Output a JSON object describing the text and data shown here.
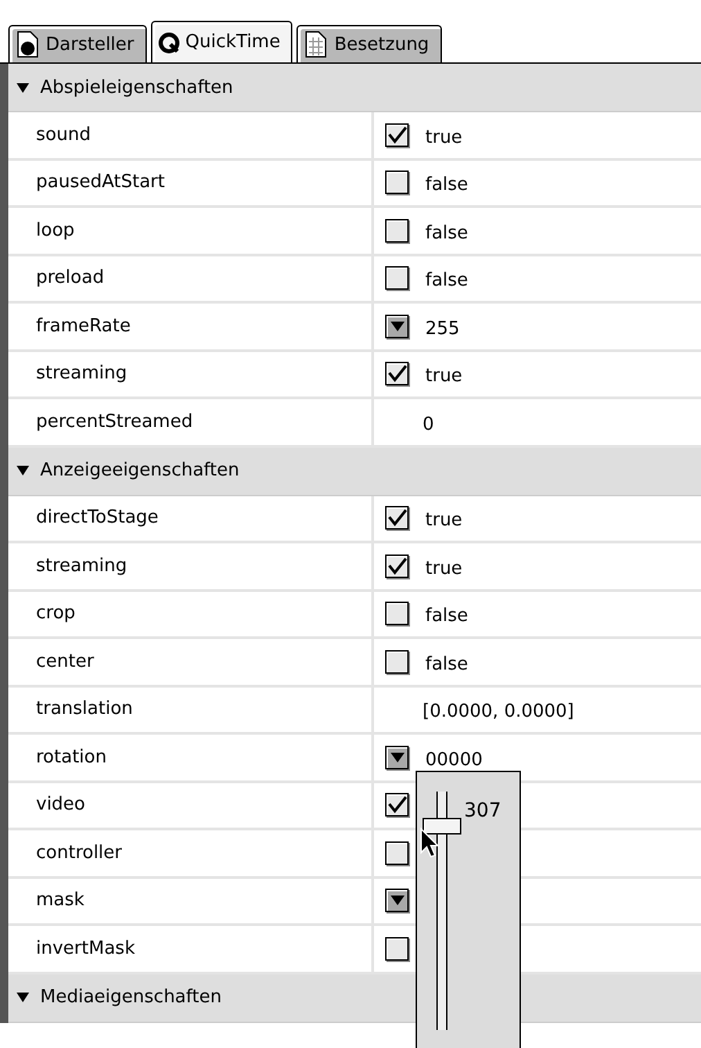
{
  "tabs": [
    {
      "label": "Darsteller",
      "kind": "member",
      "selected": false
    },
    {
      "label": "QuickTime",
      "kind": "quicktime",
      "selected": true
    },
    {
      "label": "Besetzung",
      "kind": "cast",
      "selected": false
    }
  ],
  "sections": [
    {
      "title": "Abspieleigenschaften",
      "expanded": true,
      "rows": [
        {
          "name": "sound",
          "kind": "checkbox",
          "checked": true,
          "value": "true"
        },
        {
          "name": "pausedAtStart",
          "kind": "checkbox",
          "checked": false,
          "value": "false"
        },
        {
          "name": "loop",
          "kind": "checkbox",
          "checked": false,
          "value": "false"
        },
        {
          "name": "preload",
          "kind": "checkbox",
          "checked": false,
          "value": "false"
        },
        {
          "name": "frameRate",
          "kind": "dropdown",
          "value": "255"
        },
        {
          "name": "streaming",
          "kind": "checkbox",
          "checked": true,
          "value": "true"
        },
        {
          "name": "percentStreamed",
          "kind": "text",
          "value": "0"
        }
      ]
    },
    {
      "title": "Anzeigeeigenschaften",
      "expanded": true,
      "rows": [
        {
          "name": "directToStage",
          "kind": "checkbox",
          "checked": true,
          "value": "true"
        },
        {
          "name": "streaming",
          "kind": "checkbox",
          "checked": true,
          "value": "true"
        },
        {
          "name": "crop",
          "kind": "checkbox",
          "checked": false,
          "value": "false"
        },
        {
          "name": "center",
          "kind": "checkbox",
          "checked": false,
          "value": "false"
        },
        {
          "name": "translation",
          "kind": "text",
          "value": "[0.0000, 0.0000]"
        },
        {
          "name": "rotation",
          "kind": "dropdown",
          "value": "00000"
        },
        {
          "name": "video",
          "kind": "checkbox",
          "checked": true
        },
        {
          "name": "controller",
          "kind": "checkbox",
          "checked": false
        },
        {
          "name": "mask",
          "kind": "dropdown"
        },
        {
          "name": "invertMask",
          "kind": "checkbox",
          "checked": false
        }
      ]
    },
    {
      "title": "Mediaeigenschaften",
      "expanded": true
    }
  ],
  "popup": {
    "value": "307",
    "level": 0.88
  }
}
